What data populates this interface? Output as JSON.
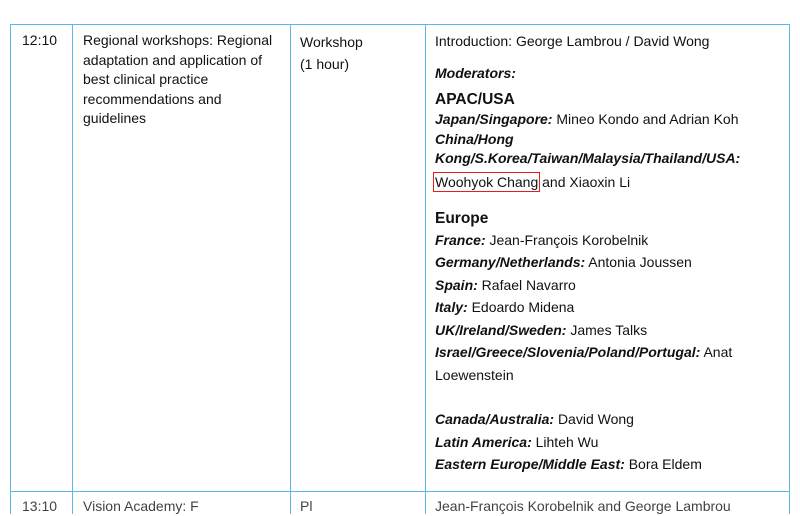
{
  "row": {
    "time": "12:10",
    "session": "Regional workshops: Regional adaptation and application of best clinical practice recommendations and guidelines",
    "format_line1": "Workshop",
    "format_line2": "(1 hour)",
    "introduction": "Introduction: George Lambrou / David Wong",
    "moderators_label": "Moderators:",
    "apac": {
      "heading": "APAC/USA",
      "entries": [
        {
          "region": "Japan/Singapore:",
          "names": "Mineo Kondo and Adrian Koh"
        },
        {
          "region_line1": "China/Hong",
          "region_line2": "Kong/S.Korea/Taiwan/Malaysia/Thailand/USA:",
          "highlighted_name": "Woohyok Chang",
          "names_rest": " and Xiaoxin Li"
        }
      ]
    },
    "europe": {
      "heading": "Europe",
      "entries": [
        {
          "region": "France:",
          "names": "Jean-François Korobelnik"
        },
        {
          "region": "Germany/Netherlands:",
          "names": "Antonia Joussen"
        },
        {
          "region": "Spain:",
          "names": "Rafael Navarro"
        },
        {
          "region": "Italy:",
          "names": "Edoardo Midena"
        },
        {
          "region": "UK/Ireland/Sweden:",
          "names": "James Talks"
        },
        {
          "region": "Israel/Greece/Slovenia/Poland/Portugal:",
          "names": "Anat Loewenstein"
        }
      ]
    },
    "others": [
      {
        "region": "Canada/Australia:",
        "names": "David Wong"
      },
      {
        "region": "Latin America:",
        "names": "Lihteh Wu"
      },
      {
        "region": "Eastern Europe/Middle East:",
        "names": "Bora Eldem"
      }
    ]
  },
  "next_row_cutoff": {
    "time": "13:10",
    "session": "Vision Academy: F",
    "format": "Pl",
    "detail": "Jean-François Korobelnik and George Lambrou"
  },
  "colors": {
    "border": "#5bb8e8",
    "highlight": "#e02020"
  }
}
